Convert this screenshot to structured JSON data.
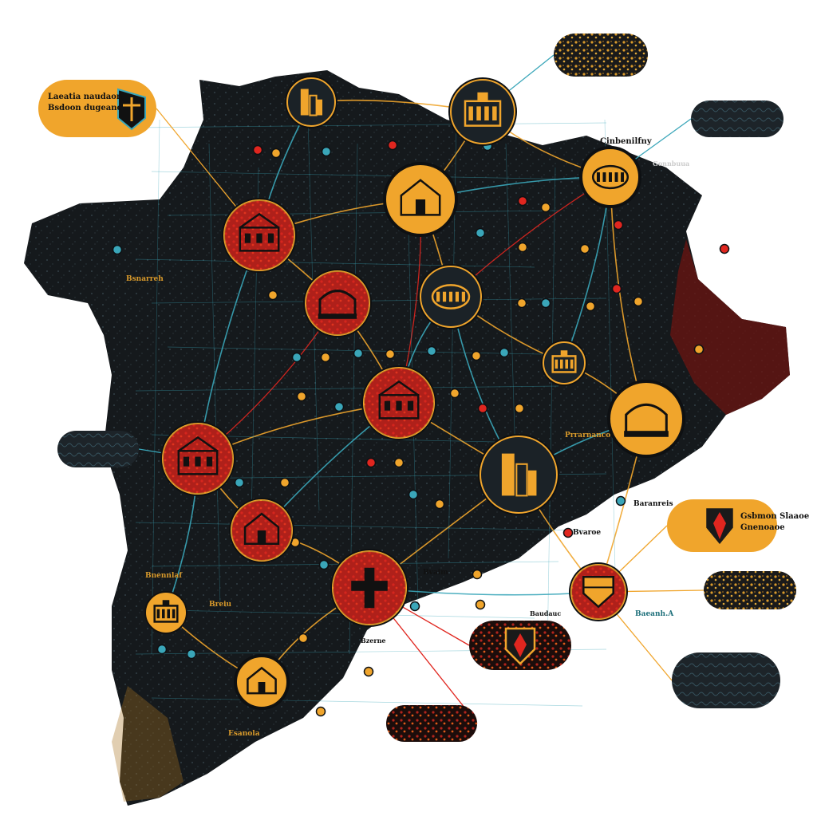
{
  "colors": {
    "land": "#15191c",
    "land_red": "#8a1612",
    "teal": "#3aa6b9",
    "gold": "#f0a52c",
    "red": "#e0261f",
    "dark_badge": "#1b2227",
    "ink": "#111111",
    "white": "#ffffff"
  },
  "map": {
    "labels": [
      {
        "text": "Cinbenilfny"
      },
      {
        "text": "Gonnbuua"
      },
      {
        "text": "Bsnarreh"
      },
      {
        "text": "Baranreis"
      },
      {
        "text": "Bvaroe"
      },
      {
        "text": "Bvaim"
      },
      {
        "text": "Baudauc"
      },
      {
        "text": "Baeanh.A"
      },
      {
        "text": "Bzerne"
      },
      {
        "text": "Esanola"
      },
      {
        "text": "Prrarnanco"
      },
      {
        "text": "Bnennlaf"
      },
      {
        "text": "Breiu"
      }
    ],
    "cities": [
      {
        "icon": "castle-icon"
      },
      {
        "icon": "tower-icon"
      },
      {
        "icon": "palace-icon"
      },
      {
        "icon": "cathedral-icon"
      },
      {
        "icon": "arch-icon"
      },
      {
        "icon": "colosseum-icon"
      },
      {
        "icon": "temple-icon"
      },
      {
        "icon": "townhall-icon"
      },
      {
        "icon": "fort-icon"
      },
      {
        "icon": "castle-icon"
      },
      {
        "icon": "skyline-icon"
      },
      {
        "icon": "gate-icon"
      },
      {
        "icon": "shrine-icon"
      },
      {
        "icon": "cross-icon"
      },
      {
        "icon": "shield-icon"
      },
      {
        "icon": "cathedral-icon"
      }
    ],
    "callouts": [
      {
        "icon": "figure-icon",
        "text": "Laeatia naudaon, Bsdoon dugeane"
      },
      {
        "icon": "",
        "text": ""
      },
      {
        "icon": "",
        "text": ""
      },
      {
        "icon": "",
        "text": ""
      },
      {
        "icon": "shield-icon",
        "text": "Gsbmon Slaaoe Gnenoaoe"
      },
      {
        "icon": "",
        "text": ""
      },
      {
        "icon": "",
        "text": ""
      },
      {
        "icon": "shield-icon",
        "text": ""
      },
      {
        "icon": "",
        "text": ""
      }
    ]
  }
}
